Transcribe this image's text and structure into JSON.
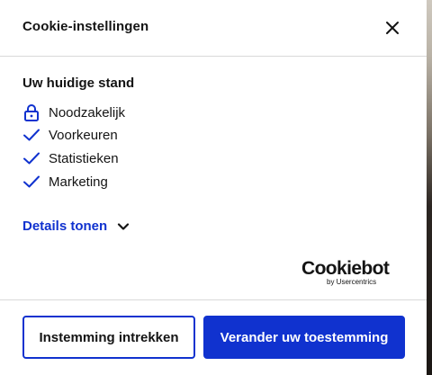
{
  "dialog": {
    "title": "Cookie-instellingen",
    "close_icon": "close-icon"
  },
  "current_state": {
    "title": "Uw huidige stand",
    "items": [
      {
        "label": "Noodzakelijk",
        "icon": "lock-icon"
      },
      {
        "label": "Voorkeuren",
        "icon": "check-icon"
      },
      {
        "label": "Statistieken",
        "icon": "check-icon"
      },
      {
        "label": "Marketing",
        "icon": "check-icon"
      }
    ]
  },
  "details": {
    "label": "Details tonen",
    "icon": "chevron-down-icon"
  },
  "brand": {
    "name": "Cookiebot",
    "sub": "by Usercentrics"
  },
  "actions": {
    "withdraw_label": "Instemming intrekken",
    "change_label": "Verander uw toestemming"
  },
  "colors": {
    "accent": "#1032cf",
    "text": "#141414",
    "divider": "#d9d9d9"
  }
}
